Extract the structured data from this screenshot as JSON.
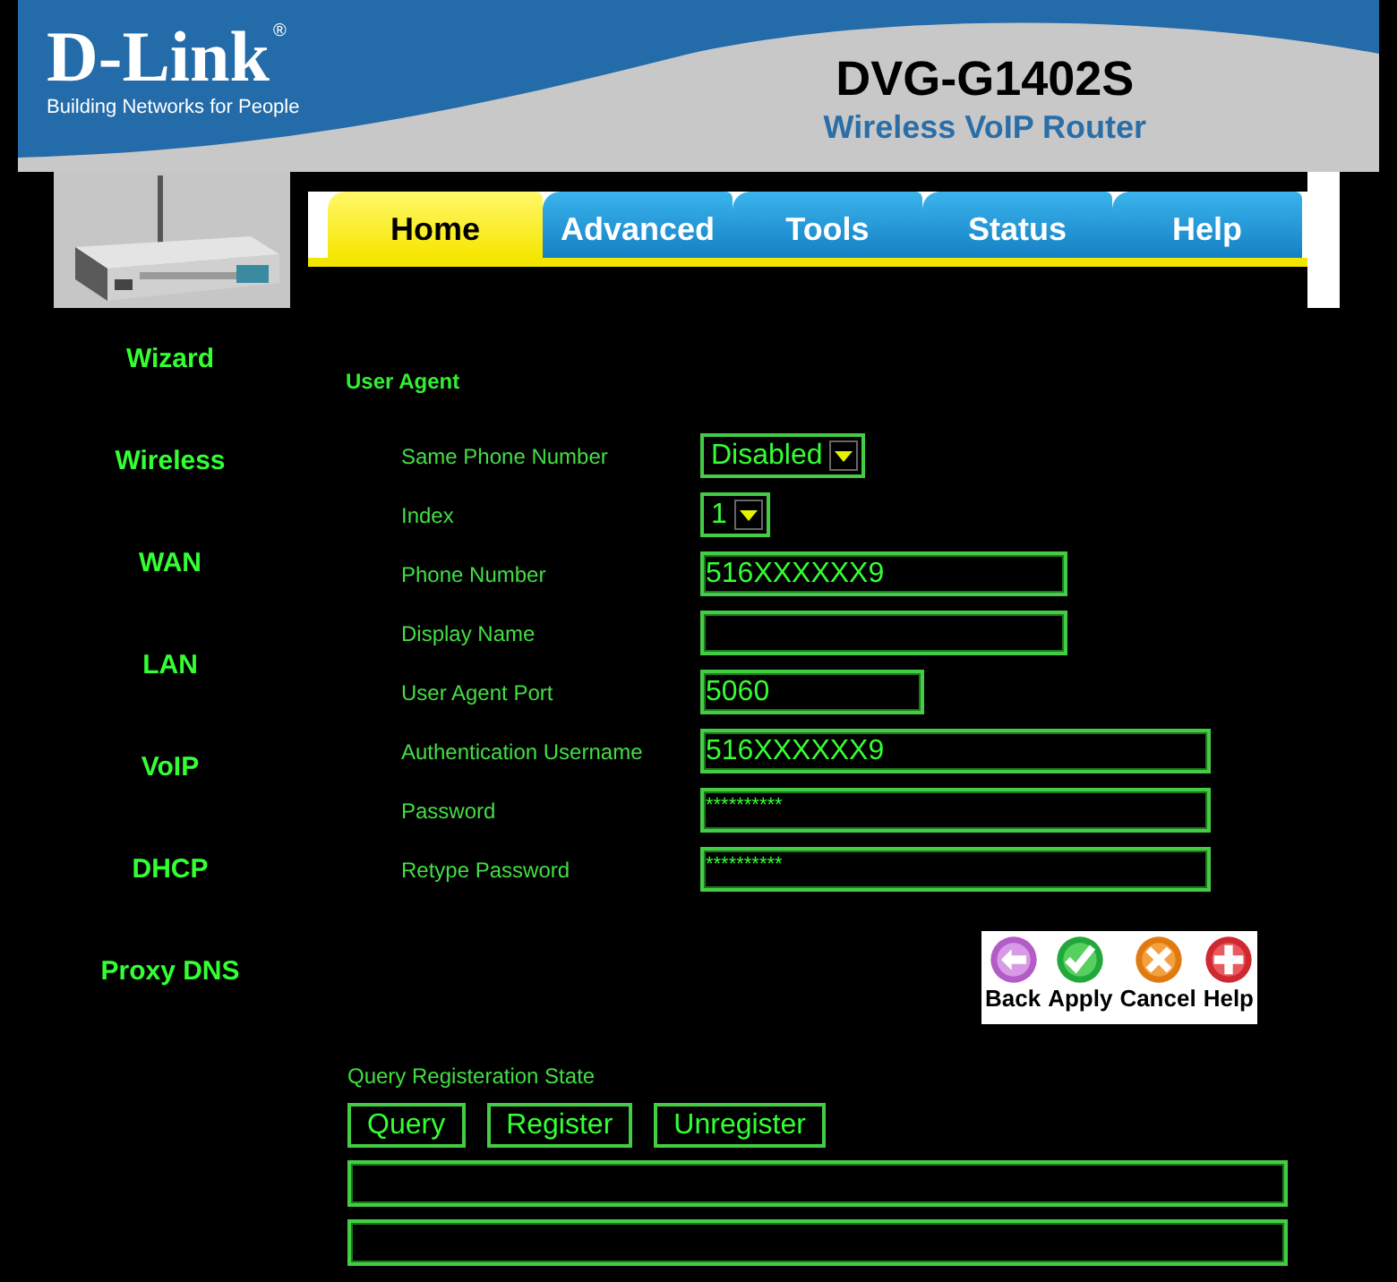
{
  "header": {
    "logo": "D-Link",
    "registered_mark": "®",
    "tagline": "Building Networks for People",
    "model": "DVG-G1402S",
    "product": "Wireless VoIP Router"
  },
  "tabs": [
    {
      "label": "Home",
      "selected": true
    },
    {
      "label": "Advanced",
      "selected": false
    },
    {
      "label": "Tools",
      "selected": false
    },
    {
      "label": "Status",
      "selected": false
    },
    {
      "label": "Help",
      "selected": false
    }
  ],
  "sidebar": {
    "items": [
      {
        "label": "Wizard"
      },
      {
        "label": "Wireless"
      },
      {
        "label": "WAN"
      },
      {
        "label": "LAN"
      },
      {
        "label": "VoIP"
      },
      {
        "label": "DHCP"
      },
      {
        "label": "Proxy DNS"
      }
    ]
  },
  "section_title": "User Agent",
  "fields": [
    {
      "kind": "select",
      "label": "Same Phone Number",
      "value": "Disabled"
    },
    {
      "kind": "select",
      "label": "Index",
      "value": "1"
    },
    {
      "kind": "text",
      "label": "Phone Number",
      "value": "516XXXXXX9"
    },
    {
      "kind": "text",
      "label": "Display Name"
    },
    {
      "kind": "port",
      "label": "User Agent Port",
      "value": "5060"
    },
    {
      "kind": "account",
      "label": "Authentication Username",
      "value": "516XXXXXX9"
    },
    {
      "kind": "password",
      "label": "Password",
      "value": "**********"
    },
    {
      "kind": "password",
      "label": "Retype Password",
      "value": "**********"
    }
  ],
  "actions": [
    {
      "kind": "back",
      "label": "Back"
    },
    {
      "kind": "apply",
      "label": "Apply"
    },
    {
      "kind": "cancel",
      "label": "Cancel"
    },
    {
      "kind": "help",
      "label": "Help"
    }
  ],
  "registration": {
    "title": "Query Registeration State",
    "buttons": [
      "Query",
      "Register",
      "Unregister"
    ],
    "result_fields": [
      {
        "kind": "status"
      },
      {
        "kind": "status"
      }
    ]
  }
}
